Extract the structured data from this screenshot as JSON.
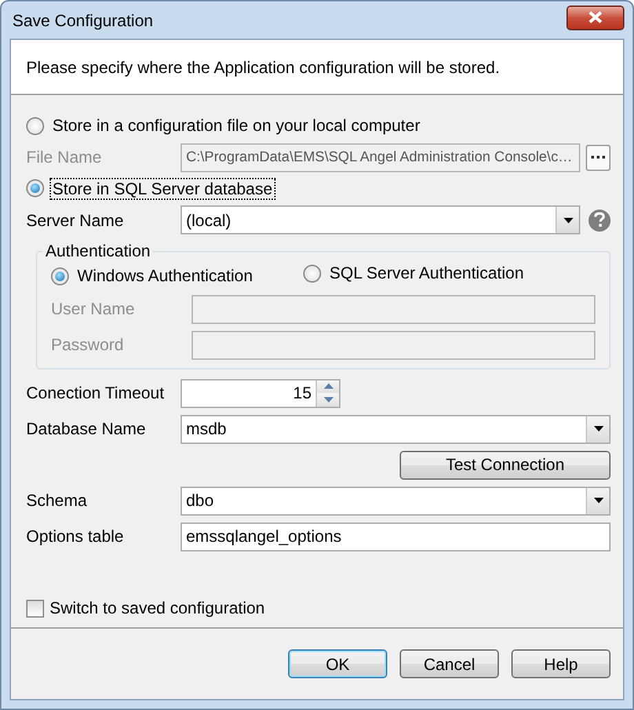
{
  "window": {
    "title": "Save Configuration"
  },
  "instruction": "Please specify where the Application configuration will be stored.",
  "storage_options": [
    {
      "label": "Store in a configuration file on your local computer",
      "selected": false,
      "focused": false
    },
    {
      "label": "Store in SQL Server database",
      "selected": true,
      "focused": true
    }
  ],
  "file_name": {
    "label": "File Name",
    "value": "C:\\ProgramData\\EMS\\SQL Angel Administration Console\\c…",
    "disabled": true
  },
  "server_name": {
    "label": "Server Name",
    "value": "(local)"
  },
  "authentication": {
    "title": "Authentication",
    "methods": [
      {
        "label": "Windows Authentication",
        "selected": true
      },
      {
        "label": "SQL Server Authentication",
        "selected": false
      }
    ],
    "user_name": {
      "label": "User Name",
      "disabled": true
    },
    "password": {
      "label": "Password",
      "disabled": true
    }
  },
  "connection_timeout": {
    "label": "Conection Timeout",
    "value": "15"
  },
  "database_name": {
    "label": "Database Name",
    "value": "msdb"
  },
  "test_button": {
    "label": "Test Connection"
  },
  "schema": {
    "label": "Schema",
    "value": "dbo"
  },
  "options_table": {
    "label": "Options table",
    "value": "emssqlangel_options"
  },
  "switch_option": {
    "label": "Switch to saved configuration",
    "checked": false
  },
  "buttons": [
    {
      "label": "OK",
      "default": true
    },
    {
      "label": "Cancel",
      "default": false
    },
    {
      "label": "Help",
      "default": false
    }
  ]
}
